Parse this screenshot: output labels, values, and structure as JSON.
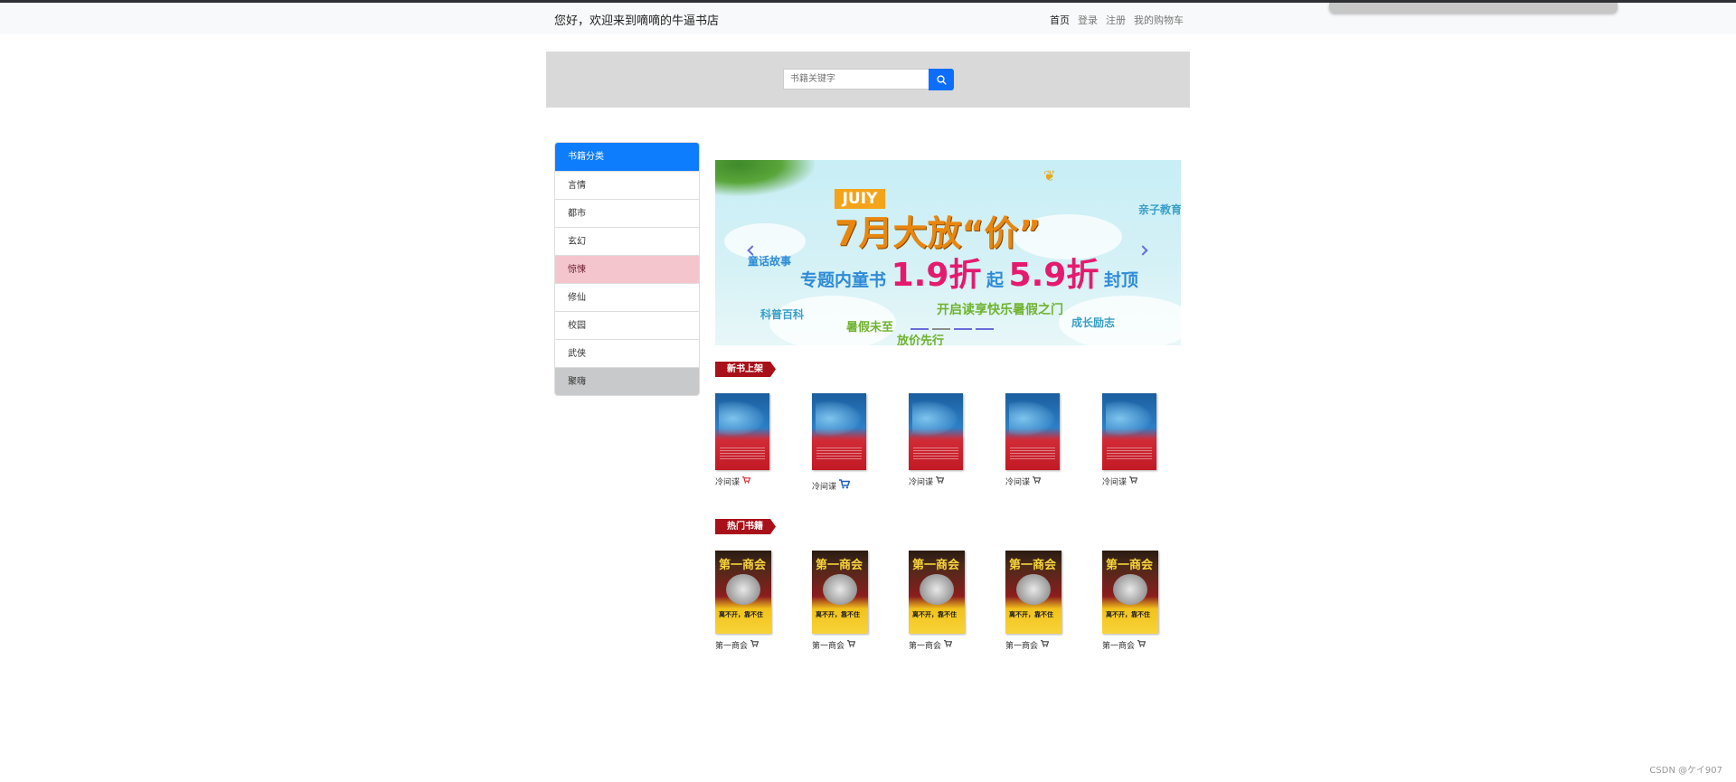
{
  "navbar": {
    "greeting": "您好，欢迎来到嘀嘀的牛逼书店",
    "links": [
      "首页",
      "登录",
      "注册",
      "我的购物车"
    ]
  },
  "search": {
    "placeholder": "书籍关键字",
    "button_icon": "search-icon"
  },
  "categories": {
    "header": "书籍分类",
    "items": [
      "言情",
      "都市",
      "玄幻",
      "惊悚",
      "修仙",
      "校园",
      "武侠",
      "聚嗨"
    ]
  },
  "banner": {
    "tag_top": "JUIY",
    "headline": "7月大放“价”",
    "promo": {
      "prefix": "专题内童书",
      "value1": "1.9折",
      "mid": "起",
      "value2": "5.9折",
      "suffix": "封顶"
    },
    "subline": "开启读享快乐暑假之门",
    "tags": [
      "童话故事",
      "亲子教育",
      "科普百科",
      "成长励志",
      "暑假未至",
      "放价先行"
    ],
    "indicators": 4,
    "active_indicator": 1
  },
  "sections": {
    "new_books": {
      "title": "新书上架",
      "books": [
        {
          "title": "冷间谍",
          "cart_color": "#d9252f"
        },
        {
          "title": "冷间谍",
          "cart_color": "#1f5fbd"
        },
        {
          "title": "冷间谍",
          "cart_color": "#444444"
        },
        {
          "title": "冷间谍",
          "cart_color": "#444444"
        },
        {
          "title": "冷间谍",
          "cart_color": "#444444"
        }
      ]
    },
    "hot_books": {
      "title": "热门书籍",
      "books": [
        {
          "title": "第一商会",
          "cover_title": "第一商会",
          "cover_slogan": "离不开，靠不住"
        },
        {
          "title": "第一商会",
          "cover_title": "第一商会",
          "cover_slogan": "离不开，靠不住"
        },
        {
          "title": "第一商会",
          "cover_title": "第一商会",
          "cover_slogan": "离不开，靠不住"
        },
        {
          "title": "第一商会",
          "cover_title": "第一商会",
          "cover_slogan": "离不开，靠不住"
        },
        {
          "title": "第一商会",
          "cover_title": "第一商会",
          "cover_slogan": "离不开，靠不住"
        }
      ]
    }
  },
  "watermark": "CSDN @ケイ907",
  "colors": {
    "primary": "#0d6efd",
    "section_tag": "#a8101a",
    "pink_highlight": "#f4c5cd",
    "gray_highlight": "#c8c9ca"
  }
}
